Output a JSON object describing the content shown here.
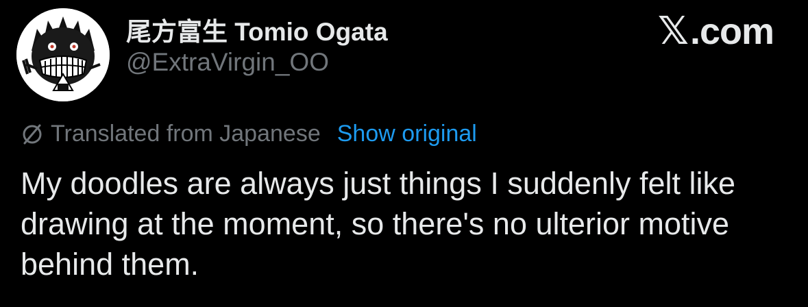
{
  "post": {
    "author_name": "尾方富生 Tomio Ogata",
    "author_handle": "@ExtraVirgin_OO",
    "translation_label": "Translated from Japanese",
    "show_original_label": "Show original",
    "text": "My doodles are always just things I suddenly felt like drawing at the moment, so there's no ulterior motive behind them."
  },
  "site_badge": {
    "icon": "x-logo-icon",
    "label": ".com"
  },
  "colors": {
    "background": "#000000",
    "primary_text": "#e7e9ea",
    "secondary_text": "#71767b",
    "link": "#1d9bf0"
  }
}
